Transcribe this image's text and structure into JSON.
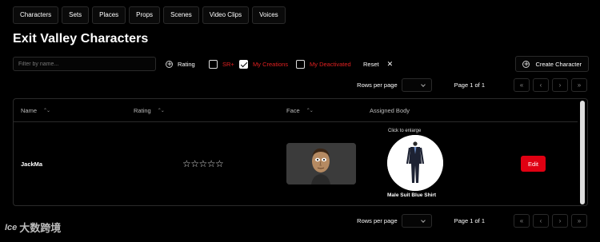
{
  "tabs": [
    "Characters",
    "Sets",
    "Places",
    "Props",
    "Scenes",
    "Video Clips",
    "Voices"
  ],
  "page_title": "Exit Valley Characters",
  "filter": {
    "placeholder": "Filter by name..."
  },
  "toolbar": {
    "rating_label": "Rating",
    "sr_label": "SR+",
    "sr_checked": false,
    "my_creations_label": "My Creations",
    "my_creations_checked": true,
    "my_deactivated_label": "My Deactivated",
    "my_deactivated_checked": false,
    "reset_label": "Reset",
    "create_label": "Create Character"
  },
  "pagination": {
    "rows_per_page_label": "Rows per page",
    "page_label": "Page 1 of 1"
  },
  "table": {
    "headers": [
      "Name",
      "Rating",
      "Face",
      "Assigned Body"
    ],
    "rows": [
      {
        "name": "JackMa",
        "rating_stars": "☆☆☆☆☆",
        "click_hint": "Click to enlarge",
        "body_name": "Male Suit Blue Shirt",
        "edit_label": "Edit"
      }
    ]
  },
  "colors": {
    "accent_red": "#e00012",
    "label_red": "#e02020",
    "background": "#000000"
  },
  "icons": [
    "plus-circle-icon",
    "close-icon",
    "chevron-down-icon",
    "first-page-icon",
    "prev-page-icon",
    "next-page-icon",
    "last-page-icon",
    "sort-icon"
  ],
  "watermark": {
    "logo": "Ice",
    "text": "大数跨境"
  }
}
